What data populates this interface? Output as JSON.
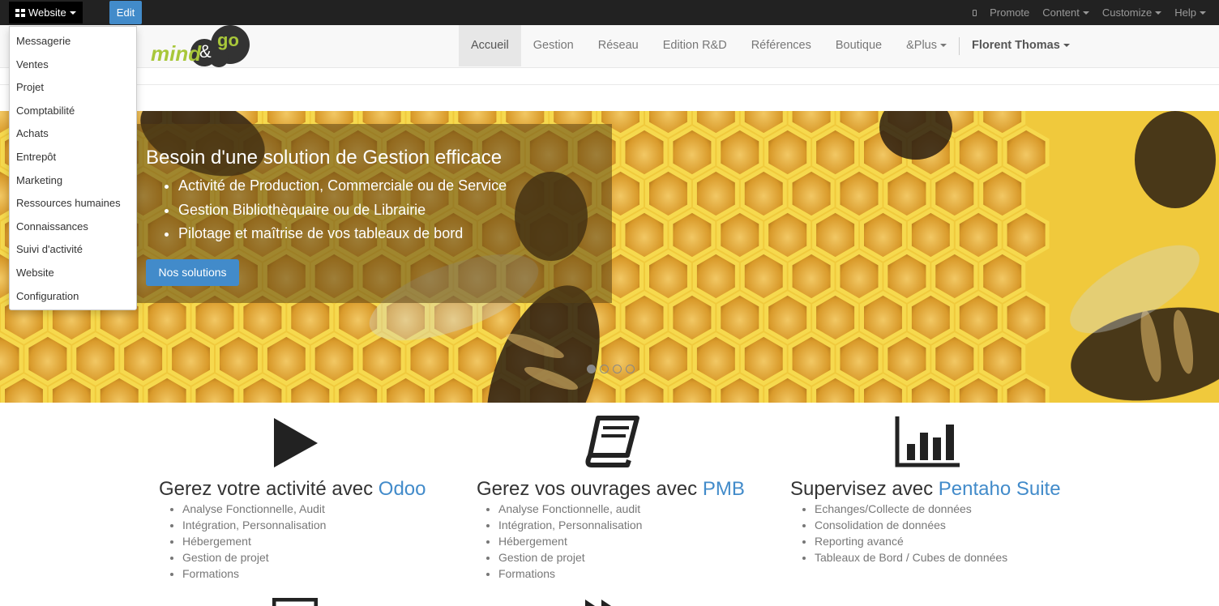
{
  "topbar": {
    "apps_label": "Website",
    "edit_label": "Edit",
    "right_items": [
      "Promote",
      "Content",
      "Customize",
      "Help"
    ]
  },
  "app_menu": {
    "items": [
      "Messagerie",
      "Ventes",
      "Projet",
      "Comptabilité",
      "Achats",
      "Entrepôt",
      "Marketing",
      "Ressources humaines",
      "Connaissances",
      "Suivi d'activité",
      "Website",
      "Configuration"
    ]
  },
  "navbar": {
    "logo_text": "mind&go",
    "items": [
      "Accueil",
      "Gestion",
      "Réseau",
      "Edition R&D",
      "Références",
      "Boutique",
      "&Plus"
    ],
    "active": "Accueil",
    "user": "Florent Thomas"
  },
  "hero": {
    "title": "Besoin d'une solution de Gestion efficace",
    "bullets": [
      "Activité de Production, Commerciale ou de Service",
      "Gestion Bibliothèquaire ou de Librairie",
      "Pilotage et maîtrise de vos tableaux de bord"
    ],
    "button": "Nos solutions",
    "slides": 4,
    "active_slide": 1
  },
  "features": [
    {
      "icon": "play-icon",
      "title_prefix": "Gerez votre activité avec ",
      "highlight": "Odoo",
      "bullets": [
        "Analyse Fonctionnelle, Audit",
        "Intégration, Personnalisation",
        "Hébergement",
        "Gestion de projet",
        "Formations"
      ]
    },
    {
      "icon": "book-icon",
      "title_prefix": "Gerez vos ouvrages avec ",
      "highlight": "PMB",
      "bullets": [
        "Analyse Fonctionnelle, audit",
        "Intégration, Personnalisation",
        "Hébergement",
        "Gestion de projet",
        "Formations"
      ]
    },
    {
      "icon": "bar-chart-icon",
      "title_prefix": "Supervisez avec ",
      "highlight": "Pentaho Suite",
      "bullets": [
        "Echanges/Collecte de données",
        "Consolidation de données",
        "Reporting avancé",
        "Tableaux de Bord / Cubes de données"
      ]
    }
  ],
  "colors": {
    "accent": "#428bca",
    "topbar": "#222222",
    "navbar": "#f8f8f8",
    "logo_green": "#a8c73a",
    "logo_dark": "#333333"
  }
}
